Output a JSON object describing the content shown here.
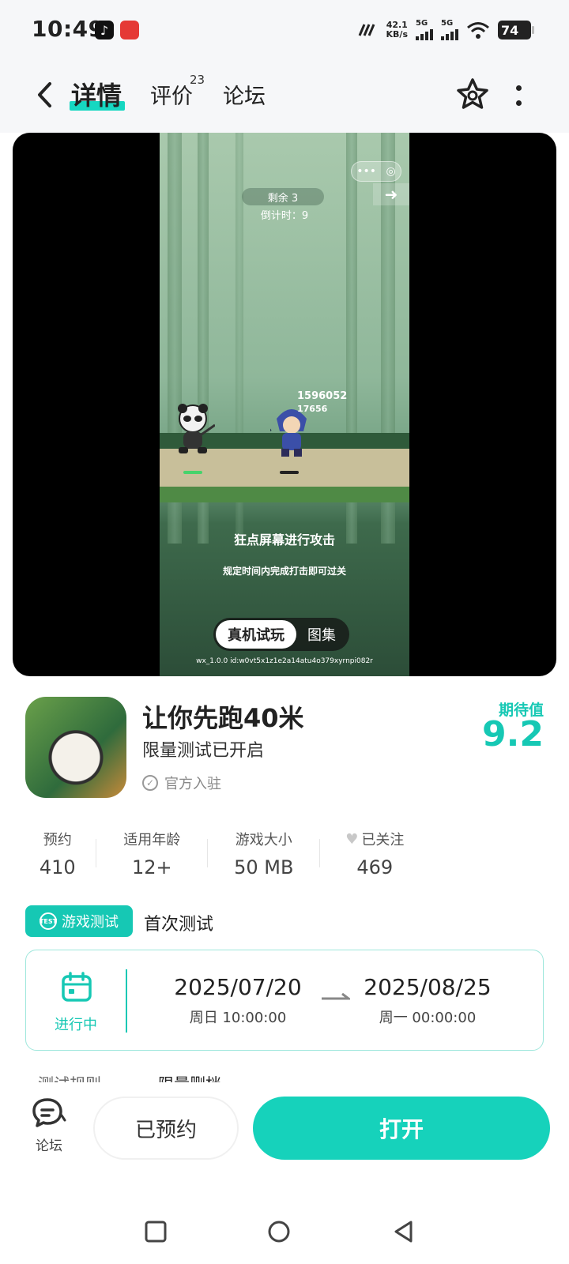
{
  "status_bar": {
    "time": "10:49",
    "net_speed_value": "42.1",
    "net_speed_unit": "KB/s",
    "sim1": "5G",
    "sim2": "5G",
    "battery": "74",
    "icons": [
      "tiktok-icon",
      "red-app-icon",
      "net-icon",
      "signal-icon",
      "signal-icon",
      "wifi-icon",
      "battery-icon"
    ]
  },
  "nav": {
    "tabs": [
      {
        "label": "详情",
        "active": true
      },
      {
        "label": "评价",
        "badge": "23"
      },
      {
        "label": "论坛"
      }
    ]
  },
  "media": {
    "remain": "剩余 3",
    "countdown": "倒计时：9",
    "damage_1": "1596052",
    "damage_2": "17656",
    "tap_tip": "狂点屏幕进行攻击",
    "rule_tip": "规定时间内完成打击即可过关",
    "switch_active": "真机试玩",
    "switch_inactive": "图集",
    "wx_id": "wx_1.0.0 id:w0vt5x1z1e2a14atu4o379xyrnpi082r"
  },
  "game": {
    "title": "让你先跑40米",
    "subtitle": "限量测试已开启",
    "official": "官方入驻",
    "expect_label": "期待值",
    "expect_value": "9.2"
  },
  "stats": [
    {
      "label": "预约",
      "value": "410"
    },
    {
      "label": "适用年龄",
      "value": "12+"
    },
    {
      "label": "游戏大小",
      "value": "50 MB"
    },
    {
      "label": "已关注",
      "value": "469"
    }
  ],
  "test": {
    "badge": "游戏测试",
    "badge_icon_text": "TEST",
    "name": "首次测试",
    "status": "进行中",
    "start_date": "2025/07/20",
    "start_time": "周日  10:00:00",
    "end_date": "2025/08/25",
    "end_time": "周一  00:00:00",
    "rules_label": "测试规则",
    "rules_value": "限量删档"
  },
  "actions": {
    "forum": "论坛",
    "reserved": "已预约",
    "open": "打开"
  },
  "colors": {
    "accent": "#16c8b4",
    "primary_button": "#16d2bb"
  }
}
